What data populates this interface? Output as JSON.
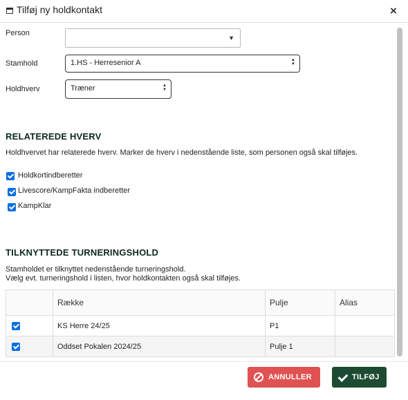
{
  "dialog": {
    "title": "Tilføj ny holdkontakt",
    "close_glyph": "×"
  },
  "form": {
    "person_label": "Person",
    "person_value": "",
    "stamhold_label": "Stamhold",
    "stamhold_value": "1.HS - Herresenior A",
    "holdhverv_label": "Holdhverv",
    "holdhverv_value": "Træner"
  },
  "related": {
    "title": "RELATEREDE HVERV",
    "description": "Holdhvervet har relaterede hverv. Marker de hverv i nedenstående liste, som personen også skal tilføjes.",
    "items": [
      {
        "label": "Holdkortindberetter",
        "checked": true
      },
      {
        "label": "Livescore/KampFakta indberetter",
        "checked": true
      },
      {
        "label": "KampKlar",
        "checked": true
      }
    ]
  },
  "teams": {
    "title": "TILKNYTTEDE TURNERINGSHOLD",
    "description_line1": "Stamholdet er tilknyttet nedenstående turneringshold.",
    "description_line2": "Vælg evt. turneringshold i listen, hvor holdkontakten også skal tilføjes.",
    "columns": [
      "",
      "Række",
      "Pulje",
      "Alias"
    ],
    "rows": [
      {
        "checked": true,
        "raekke": "KS Herre 24/25",
        "pulje": "P1",
        "alias": ""
      },
      {
        "checked": true,
        "raekke": "Oddset Pokalen 2024/25",
        "pulje": "Pulje 1",
        "alias": ""
      }
    ]
  },
  "footer": {
    "cancel_label": "ANNULLER",
    "add_label": "TILFØJ"
  },
  "colors": {
    "accent_blue": "#0a6fe0",
    "cancel_red": "#e05252",
    "add_green": "#1d4b32",
    "heading": "#0c2a1c"
  },
  "icons": {
    "title_icon": "window-icon",
    "close": "close-icon",
    "cancel": "cancel-circle-icon",
    "add": "check-icon"
  }
}
